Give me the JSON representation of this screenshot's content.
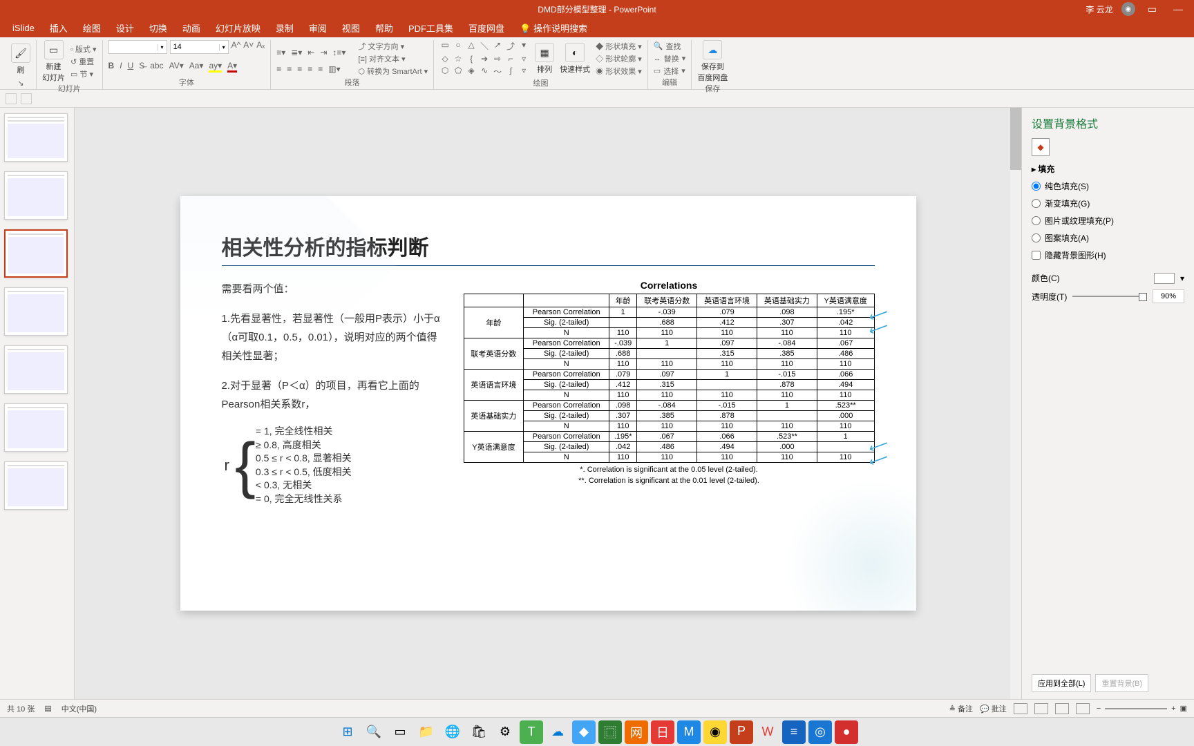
{
  "title_bar": {
    "document_title": "DMD部分模型整理",
    "app_name": "PowerPoint",
    "user_name": "李 云龙"
  },
  "tabs": [
    "iSlide",
    "插入",
    "绘图",
    "设计",
    "切换",
    "动画",
    "幻灯片放映",
    "录制",
    "审阅",
    "视图",
    "帮助",
    "PDF工具集",
    "百度网盘"
  ],
  "tell_me": "操作说明搜索",
  "ribbon": {
    "slides": {
      "new_slide": "新建\n幻灯片",
      "layout": "版式",
      "reset": "重置",
      "section": "节",
      "label": "幻灯片"
    },
    "font": {
      "size": "14",
      "label": "字体"
    },
    "paragraph": {
      "text_dir": "文字方向",
      "align": "对齐文本",
      "smartart": "转换为 SmartArt",
      "label": "段落"
    },
    "draw": {
      "arrange": "排列",
      "quick": "快速样式",
      "fill": "形状填充",
      "outline": "形状轮廓",
      "effects": "形状效果",
      "label": "绘图"
    },
    "edit": {
      "find": "查找",
      "replace": "替换",
      "select": "选择",
      "label": "编辑"
    },
    "save": {
      "save_baidu": "保存到\n百度网盘",
      "label": "保存"
    }
  },
  "slide": {
    "title": "相关性分析的指标判断",
    "intro": "需要看两个值：",
    "p1": "1.先看显著性，若显著性（一般用P表示）小于α（α可取0.1，0.5，0.01），说明对应的两个值得相关性显著；",
    "p2": "2.对于显著（P＜α）的项目，再看它上面的Pearson相关系数r，",
    "formula": {
      "l1": "= 1, 完全线性相关",
      "l2": "≥ 0.8, 高度相关",
      "l3": "0.5 ≤ r < 0.8, 显著相关",
      "l4": "0.3 ≤ r < 0.5, 低度相关",
      "l5": "< 0.3, 无相关",
      "l6": "= 0, 完全无线性关系"
    },
    "corr": {
      "title": "Correlations",
      "headers": [
        "",
        "",
        "年龄",
        "联考英语分数",
        "英语语言环境",
        "英语基础实力",
        "Y英语满意度"
      ],
      "row_labels": {
        "pc": "Pearson Correlation",
        "sig": "Sig. (2-tailed)",
        "n": "N"
      },
      "vars": [
        "年龄",
        "联考英语分数",
        "英语语言环境",
        "英语基础实力",
        "Y英语满意度"
      ],
      "data": [
        {
          "pc": [
            "1",
            "-.039",
            ".079",
            ".098",
            ".195*"
          ],
          "sig": [
            "",
            ".688",
            ".412",
            ".307",
            ".042"
          ],
          "n": [
            "110",
            "110",
            "110",
            "110",
            "110"
          ]
        },
        {
          "pc": [
            "-.039",
            "1",
            ".097",
            "-.084",
            ".067"
          ],
          "sig": [
            ".688",
            "",
            ".315",
            ".385",
            ".486"
          ],
          "n": [
            "110",
            "110",
            "110",
            "110",
            "110"
          ]
        },
        {
          "pc": [
            ".079",
            ".097",
            "1",
            "-.015",
            ".066"
          ],
          "sig": [
            ".412",
            ".315",
            "",
            ".878",
            ".494"
          ],
          "n": [
            "110",
            "110",
            "110",
            "110",
            "110"
          ]
        },
        {
          "pc": [
            ".098",
            "-.084",
            "-.015",
            "1",
            ".523**"
          ],
          "sig": [
            ".307",
            ".385",
            ".878",
            "",
            ".000"
          ],
          "n": [
            "110",
            "110",
            "110",
            "110",
            "110"
          ]
        },
        {
          "pc": [
            ".195*",
            ".067",
            ".066",
            ".523**",
            "1"
          ],
          "sig": [
            ".042",
            ".486",
            ".494",
            ".000",
            ""
          ],
          "n": [
            "110",
            "110",
            "110",
            "110",
            "110"
          ]
        }
      ],
      "note1": "*. Correlation is significant at the 0.05 level (2-tailed).",
      "note2": "**. Correlation is significant at the 0.01 level (2-tailed)."
    }
  },
  "format_pane": {
    "title": "设置背景格式",
    "fill_section": "填充",
    "solid": "纯色填充(S)",
    "gradient": "渐变填充(G)",
    "picture": "图片或纹理填充(P)",
    "pattern": "图案填充(A)",
    "hide_bg": "隐藏背景图形(H)",
    "color_label": "颜色(C)",
    "trans_label": "透明度(T)",
    "trans_value": "90%",
    "apply_all": "应用到全部(L)",
    "reset_bg": "重置背景(B)"
  },
  "status": {
    "slide_count": "共 10 张",
    "lang": "中文(中国)",
    "notes": "备注",
    "comments": "批注"
  }
}
